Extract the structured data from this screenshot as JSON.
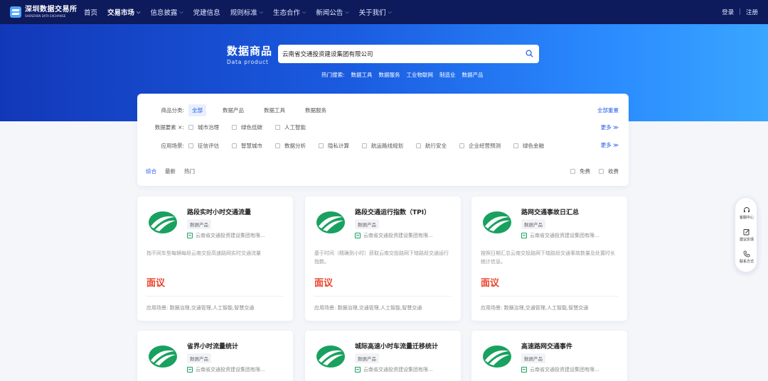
{
  "brand": {
    "name_cn": "深圳数据交易所",
    "name_en": "SHENZHEN DATA EXCHANGE"
  },
  "nav": {
    "items": [
      {
        "label": "首页",
        "dropdown": false
      },
      {
        "label": "交易市场",
        "dropdown": true,
        "active": true
      },
      {
        "label": "信息披露",
        "dropdown": true
      },
      {
        "label": "党建信息",
        "dropdown": false
      },
      {
        "label": "规则标准",
        "dropdown": true
      },
      {
        "label": "生态合作",
        "dropdown": true
      },
      {
        "label": "新闻公告",
        "dropdown": true
      },
      {
        "label": "关于我们",
        "dropdown": true
      }
    ],
    "login": "登录",
    "separator": "|",
    "register": "注册"
  },
  "hero": {
    "title_cn": "数据商品",
    "title_en": "Data product",
    "search_value": "云南省交通投资建设集团有限公司",
    "hot_label": "热门搜索:",
    "hot_items": [
      "数据工具",
      "数据服务",
      "工业物联网",
      "制造业",
      "数据产品"
    ]
  },
  "filters": {
    "category": {
      "label": "商品分类:",
      "options": [
        "全部",
        "数据产品",
        "数据工具",
        "数据服务"
      ],
      "active_index": 0
    },
    "reset": "全部重置",
    "elements": {
      "label": "数据要素 ×:",
      "options": [
        "城市治理",
        "绿色低碳",
        "人工智能"
      ]
    },
    "scenes": {
      "label": "应用场景:",
      "options": [
        "征信评估",
        "智慧城市",
        "数据分析",
        "隐私计算",
        "航运路线规划",
        "航行安全",
        "企业经营预测",
        "绿色金融"
      ]
    },
    "more": "更多 ≫",
    "sort": [
      "综合",
      "最新",
      "热门"
    ],
    "sort_active_index": 0,
    "toggles": [
      "免费",
      "收费"
    ]
  },
  "products": [
    {
      "title": "路段实时小时交通流量",
      "tag": "数据产品",
      "org": "云南省交通投资建设集团有限...",
      "desc": "指不同车型每辆每段云南交投高速路网实时交通流量",
      "price": "面议",
      "scene": "应用场景: 数据治理,交通管理,人工智能,智慧交通"
    },
    {
      "title": "路段交通运行指数（TPI）",
      "tag": "数据产品",
      "org": "云南省交通投资建设集团有限...",
      "desc": "基于时间（精确到小时）获取云南交投路网下辖路段交通运行指数。",
      "price": "面议",
      "scene": "应用场景: 数据治理,交通管理,人工智能,智慧交通"
    },
    {
      "title": "路网交通事故日汇总",
      "tag": "数据产品",
      "org": "云南省交通投资建设集团有限...",
      "desc": "按照日期汇总云南交投路网下辖路段交通事故数量及处置时长统计信息。",
      "price": "面议",
      "scene": "应用场景: 数据治理,交通管理,人工智能,智慧交通"
    },
    {
      "title": "省界小时流量统计",
      "tag": "数据产品",
      "org": "云南省交通投资建设集团有限..."
    },
    {
      "title": "城际高速小时车流量迁移统计",
      "tag": "数据产品",
      "org": "云南省交通投资建设集团有限..."
    },
    {
      "title": "高速路网交通事件",
      "tag": "数据产品",
      "org": "云南省交通投资建设集团有限..."
    }
  ],
  "side_tools": [
    "客服中心",
    "建议反馈",
    "联系方式"
  ],
  "colors": {
    "nav_bg": "#0d1a5c",
    "hero_start": "#1238b8",
    "hero_end": "#3aa6ff",
    "accent": "#1f5ae8",
    "price": "#e8432c",
    "logo_green": "#19a15f"
  }
}
